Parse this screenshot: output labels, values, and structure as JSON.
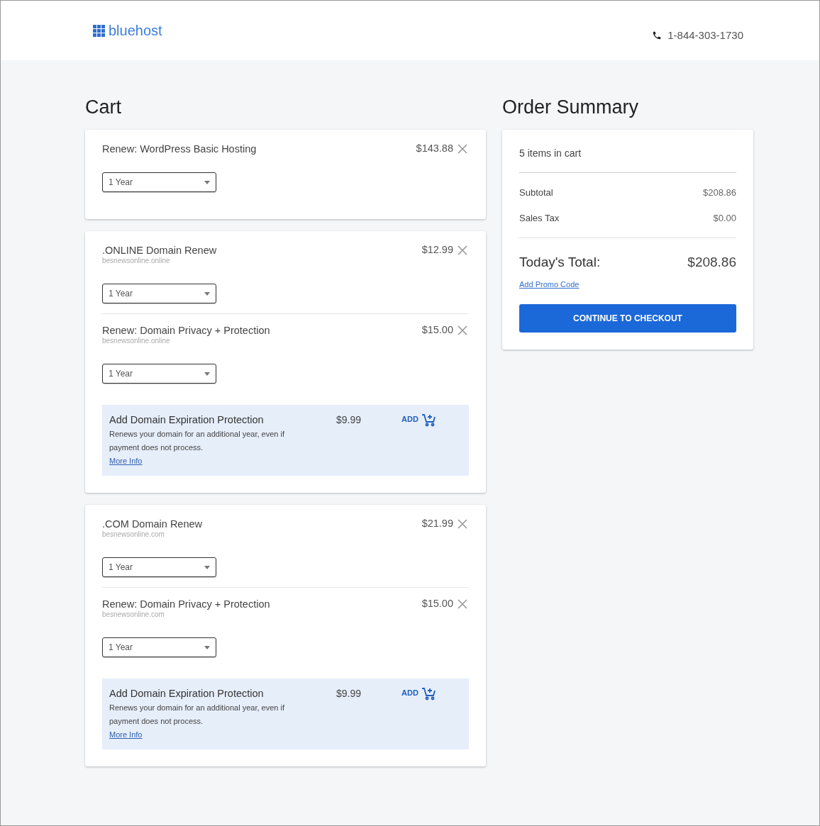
{
  "header": {
    "logo": "bluehost",
    "phone": "1-844-303-1730"
  },
  "cart": {
    "title": "Cart",
    "groups": [
      {
        "items": [
          {
            "title": "Renew: WordPress Basic Hosting",
            "price": "$143.88",
            "term": "1 Year"
          }
        ]
      },
      {
        "items": [
          {
            "title": ".ONLINE Domain Renew",
            "subtitle": "besnewsonline.online",
            "price": "$12.99",
            "term": "1 Year"
          },
          {
            "title": "Renew: Domain Privacy + Protection",
            "subtitle": "besnewsonline.online",
            "price": "$15.00",
            "term": "1 Year"
          }
        ],
        "offer": {
          "title": "Add Domain Expiration Protection",
          "price": "$9.99",
          "description": "Renews your domain for an additional year, even if payment does not process.",
          "link": "More Info",
          "action": "ADD"
        }
      },
      {
        "items": [
          {
            "title": ".COM Domain Renew",
            "subtitle": "besnewsonline.com",
            "price": "$21.99",
            "term": "1 Year"
          },
          {
            "title": "Renew: Domain Privacy + Protection",
            "subtitle": "besnewsonline.com",
            "price": "$15.00",
            "term": "1 Year"
          }
        ],
        "offer": {
          "title": "Add Domain Expiration Protection",
          "price": "$9.99",
          "description": "Renews your domain for an additional year, even if payment does not process.",
          "link": "More Info",
          "action": "ADD"
        }
      }
    ]
  },
  "summary": {
    "title": "Order Summary",
    "count": "5 items in cart",
    "lines": [
      {
        "label": "Subtotal",
        "value": "$208.86"
      },
      {
        "label": "Sales Tax",
        "value": "$0.00"
      }
    ],
    "total_label": "Today's Total:",
    "total": "$208.86",
    "promo": "Add Promo Code",
    "checkout": "CONTINUE TO CHECKOUT"
  }
}
